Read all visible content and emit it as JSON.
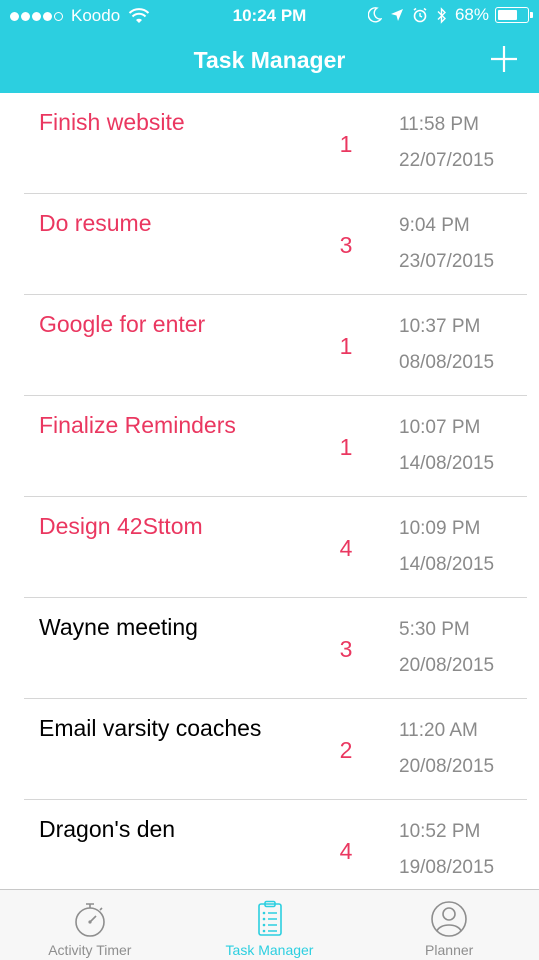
{
  "status_bar": {
    "carrier": "Koodo",
    "time": "10:24 PM",
    "battery": "68%",
    "battery_level": 0.68
  },
  "nav": {
    "title": "Task Manager"
  },
  "tasks": [
    {
      "title": "Finish website",
      "priority": "1",
      "time": "11:58 PM",
      "date": "22/07/2015",
      "highlighted": true
    },
    {
      "title": "Do resume",
      "priority": "3",
      "time": "9:04 PM",
      "date": "23/07/2015",
      "highlighted": true
    },
    {
      "title": "Google for enter",
      "priority": "1",
      "time": "10:37 PM",
      "date": "08/08/2015",
      "highlighted": true
    },
    {
      "title": "Finalize Reminders",
      "priority": "1",
      "time": "10:07 PM",
      "date": "14/08/2015",
      "highlighted": true
    },
    {
      "title": "Design 42Sttom",
      "priority": "4",
      "time": "10:09 PM",
      "date": "14/08/2015",
      "highlighted": true
    },
    {
      "title": "Wayne meeting",
      "priority": "3",
      "time": "5:30 PM",
      "date": "20/08/2015",
      "highlighted": false
    },
    {
      "title": "Email varsity coaches",
      "priority": "2",
      "time": "11:20 AM",
      "date": "20/08/2015",
      "highlighted": false
    },
    {
      "title": "Dragon's den",
      "priority": "4",
      "time": "10:52 PM",
      "date": "19/08/2015",
      "highlighted": false
    }
  ],
  "tabs": [
    {
      "label": "Activity Timer",
      "icon": "stopwatch-icon",
      "active": false
    },
    {
      "label": "Task Manager",
      "icon": "clipboard-list-icon",
      "active": true
    },
    {
      "label": "Planner",
      "icon": "person-icon",
      "active": false
    }
  ],
  "colors": {
    "accent": "#2ccfe0",
    "highlight": "#ea3760",
    "secondary_text": "#8a8a8a",
    "inactive_tab": "#8e8e8e"
  }
}
